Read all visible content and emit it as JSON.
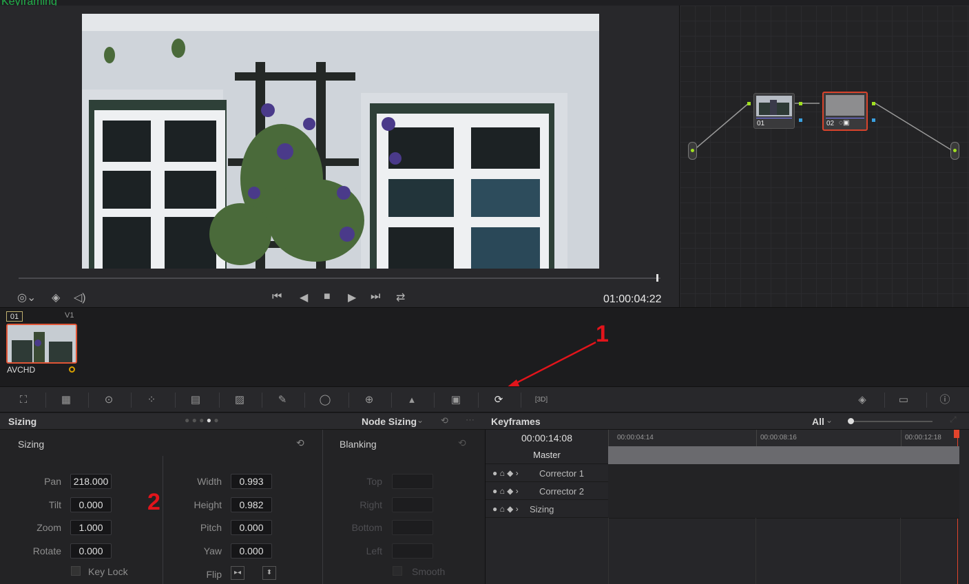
{
  "caption": "Keyframing",
  "viewer": {
    "timecode": "01:00:04:22",
    "progress": 0.995,
    "left_icons": [
      "viewer-mode-icon",
      "layers-icon",
      "volume-icon"
    ],
    "transport": [
      "skip-back-icon",
      "play-reverse-icon",
      "stop-icon",
      "play-icon",
      "skip-forward-icon",
      "loop-icon"
    ]
  },
  "nodes": {
    "node1_label": "01",
    "node2_label": "02"
  },
  "clip": {
    "badge": "01",
    "track": "V1",
    "codec": "AVCHD"
  },
  "annotations": {
    "one": "1",
    "two": "2"
  },
  "palette_icons": [
    "camera-raw-icon",
    "color-match-icon",
    "color-wheels-icon",
    "rgb-mixer-icon",
    "motion-effects-icon",
    "curves-icon",
    "qualifier-icon",
    "window-icon",
    "tracker-icon",
    "blur-icon",
    "key-icon",
    "sizing-icon",
    "3d-icon",
    "keyframes-toggle-icon",
    "scopes-icon",
    "info-icon"
  ],
  "sizing": {
    "panel_title": "Sizing",
    "mode": "Node Sizing",
    "section_title": "Sizing",
    "pan_label": "Pan",
    "pan": "218.000",
    "tilt_label": "Tilt",
    "tilt": "0.000",
    "zoom_label": "Zoom",
    "zoom": "1.000",
    "rotate_label": "Rotate",
    "rotate": "0.000",
    "keylock_label": "Key Lock",
    "width_label": "Width",
    "width": "0.993",
    "height_label": "Height",
    "height": "0.982",
    "pitch_label": "Pitch",
    "pitch": "0.000",
    "yaw_label": "Yaw",
    "yaw": "0.000",
    "flip_label": "Flip"
  },
  "blanking": {
    "title": "Blanking",
    "top_label": "Top",
    "right_label": "Right",
    "bottom_label": "Bottom",
    "left_label": "Left",
    "smooth_label": "Smooth"
  },
  "keyframes": {
    "title": "Keyframes",
    "filter": "All",
    "current_time": "00:00:14:08",
    "ruler": [
      "00:00:04:14",
      "00:00:08:16",
      "00:00:12:18"
    ],
    "master_label": "Master",
    "rows": [
      "Corrector 1",
      "Corrector 2",
      "Sizing"
    ]
  }
}
